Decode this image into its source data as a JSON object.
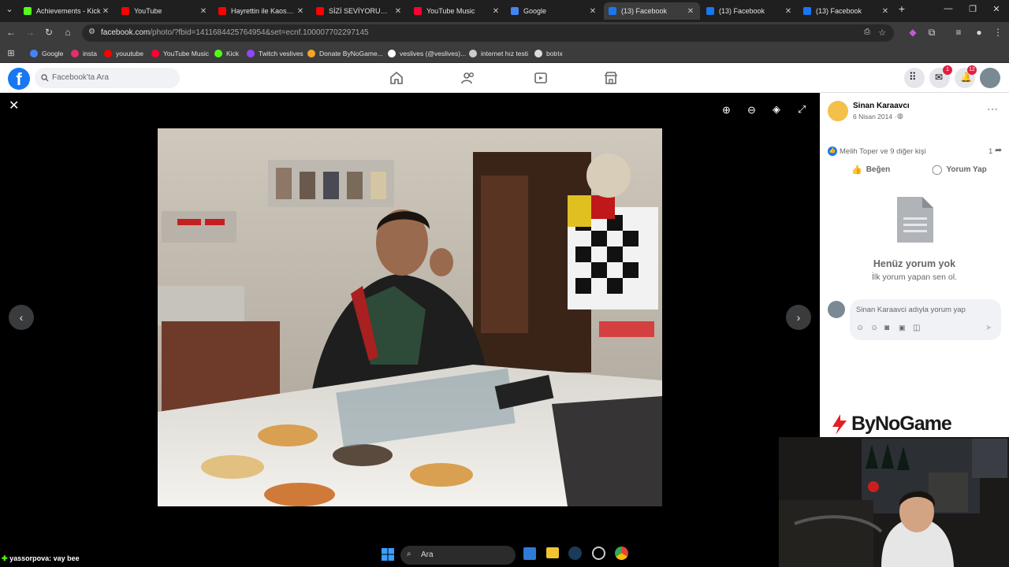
{
  "browser": {
    "tabs": [
      {
        "title": "Achievements - Kick",
        "color": "#53fc18"
      },
      {
        "title": "YouTube",
        "color": "#ff0000"
      },
      {
        "title": "Hayrettin ile Kaos Sh",
        "color": "#ff0000"
      },
      {
        "title": "SİZİ SEVİYORUM, SİZİ",
        "color": "#ff0000"
      },
      {
        "title": "YouTube Music",
        "color": "#ff0033"
      },
      {
        "title": "Google",
        "color": "#4285f4"
      },
      {
        "title": "(13) Facebook",
        "color": "#1877f2"
      },
      {
        "title": "(13) Facebook",
        "color": "#1877f2"
      },
      {
        "title": "(13) Facebook",
        "color": "#1877f2"
      }
    ],
    "url_host": "facebook.com",
    "url_rest": "/photo/?fbid=1411684425764954&set=ecnf.100007702297145",
    "bookmarks": [
      {
        "label": "Google",
        "color": "#4285f4"
      },
      {
        "label": "insta",
        "color": "#e1306c"
      },
      {
        "label": "youutube",
        "color": "#ff0000"
      },
      {
        "label": "YouTube Music",
        "color": "#ff0033"
      },
      {
        "label": "Kick",
        "color": "#53fc18"
      },
      {
        "label": "Twitch veslives",
        "color": "#9146ff"
      },
      {
        "label": "Donate ByNoGame...",
        "color": "#f5a623"
      },
      {
        "label": "veslives (@veslives)...",
        "color": "#ffffff"
      },
      {
        "label": "internet hız testi",
        "color": "#cccccc"
      },
      {
        "label": "botrix",
        "color": "#dddddd"
      }
    ]
  },
  "facebook": {
    "logo": "f",
    "search_placeholder": "Facebook'ta Ara",
    "messenger_badge": "1",
    "notifications_badge": "12"
  },
  "post": {
    "author": "Sinan Karaavcı",
    "date": "6 Nisan 2014 ·",
    "reactions": "Melih Toper ve 9 diğer kişi",
    "share_count": "1",
    "like_label": "Beğen",
    "comment_label": "Yorum Yap",
    "no_comments_title": "Henüz yorum yok",
    "no_comments_sub": "İlk yorum yapan sen ol.",
    "comment_placeholder": "Sinan Karaavci adıyla yorum yap"
  },
  "overlay": {
    "sponsor": "ByNoGame",
    "chat_user": "yassorpova",
    "chat_msg": ": vay bee"
  },
  "taskbar": {
    "search_label": "Ara"
  }
}
